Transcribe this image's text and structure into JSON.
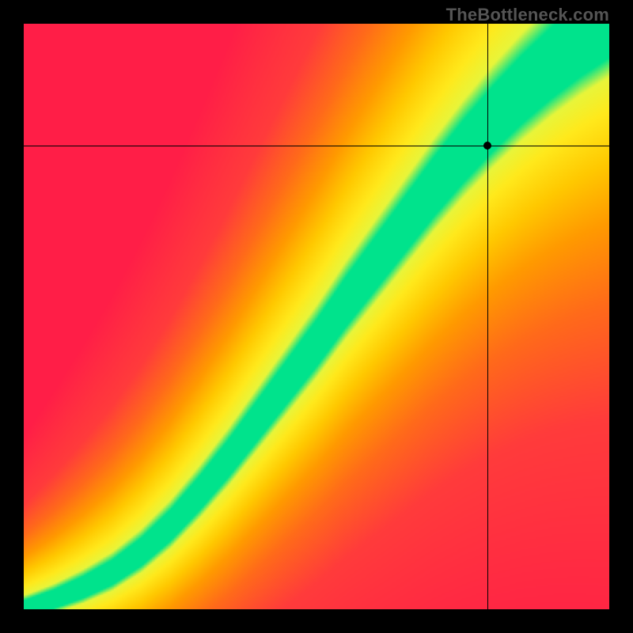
{
  "watermark": "TheBottleneck.com",
  "chart_data": {
    "type": "heatmap",
    "title": "",
    "xlabel": "",
    "ylabel": "",
    "xlim": [
      0,
      1
    ],
    "ylim": [
      0,
      1
    ],
    "grid": false,
    "legend": false,
    "crosshair": {
      "x": 0.792,
      "y": 0.792
    },
    "marker": {
      "x": 0.792,
      "y": 0.792
    },
    "band_curve": {
      "description": "Center of the green optimal band as (x, y) normalized pairs; band half-width in y tapers from ~0.015 near origin to ~0.07 near top-right.",
      "points": [
        [
          0.0,
          0.0
        ],
        [
          0.05,
          0.015
        ],
        [
          0.1,
          0.035
        ],
        [
          0.15,
          0.06
        ],
        [
          0.2,
          0.095
        ],
        [
          0.25,
          0.14
        ],
        [
          0.3,
          0.195
        ],
        [
          0.35,
          0.255
        ],
        [
          0.4,
          0.32
        ],
        [
          0.45,
          0.385
        ],
        [
          0.5,
          0.45
        ],
        [
          0.55,
          0.52
        ],
        [
          0.6,
          0.585
        ],
        [
          0.65,
          0.65
        ],
        [
          0.7,
          0.715
        ],
        [
          0.75,
          0.775
        ],
        [
          0.8,
          0.83
        ],
        [
          0.85,
          0.88
        ],
        [
          0.9,
          0.925
        ],
        [
          0.95,
          0.965
        ],
        [
          1.0,
          1.0
        ]
      ],
      "half_width_start": 0.015,
      "half_width_end": 0.075
    },
    "color_scale": {
      "description": "Distance from band center (in y, normalized to band half-width units) mapped to color.",
      "stops": [
        {
          "d": 0.0,
          "color": "#00E38C"
        },
        {
          "d": 1.0,
          "color": "#00E38C"
        },
        {
          "d": 1.6,
          "color": "#E8F53A"
        },
        {
          "d": 2.6,
          "color": "#FFE91C"
        },
        {
          "d": 4.2,
          "color": "#FFC800"
        },
        {
          "d": 6.0,
          "color": "#FF9A00"
        },
        {
          "d": 8.5,
          "color": "#FF6A1A"
        },
        {
          "d": 12.0,
          "color": "#FF3B3B"
        },
        {
          "d": 20.0,
          "color": "#FF1E47"
        }
      ]
    }
  }
}
